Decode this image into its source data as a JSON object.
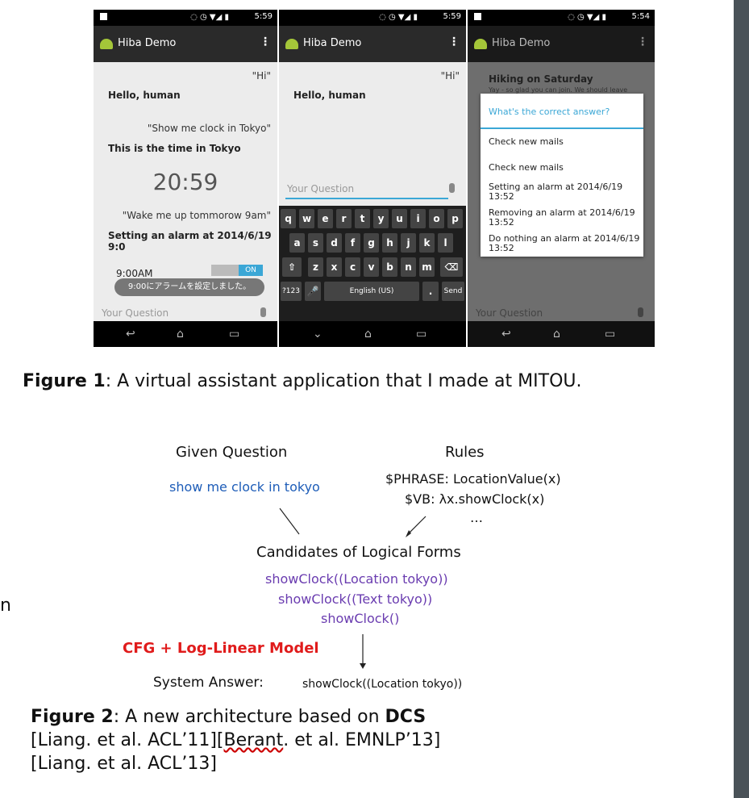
{
  "phones": {
    "p1": {
      "time": "5:59",
      "app_title": "Hiba Demo",
      "hi": "\"Hi\"",
      "hello": "Hello, human",
      "show": "\"Show me clock in Tokyo\"",
      "tokyo": "This is the time in Tokyo",
      "clock": "20:59",
      "wake": "\"Wake me up tommorow 9am\"",
      "alarm": "Setting an alarm at 2014/6/19\n9:0",
      "alarm_time": "9:00AM",
      "alarm_toggle": "ON",
      "toast": "9:00にアラームを設定しました。",
      "placeholder": "Your Question"
    },
    "p2": {
      "time": "5:59",
      "app_title": "Hiba Demo",
      "hi": "\"Hi\"",
      "hello": "Hello, human",
      "placeholder": "Your Question",
      "row1": [
        "q",
        "w",
        "e",
        "r",
        "t",
        "y",
        "u",
        "i",
        "o",
        "p"
      ],
      "row2": [
        "a",
        "s",
        "d",
        "f",
        "g",
        "h",
        "j",
        "k",
        "l"
      ],
      "row3": [
        "z",
        "x",
        "c",
        "v",
        "b",
        "n",
        "m"
      ],
      "key_123": "?123",
      "key_lang": "English (US)",
      "key_dot": ".",
      "key_send": "Send"
    },
    "p3": {
      "time": "5:54",
      "app_title": "Hiba Demo",
      "bg_title": "Hiking on Saturday",
      "bg_sub": "Yay - so glad you can join. We should leave",
      "dialog_title": "What's the correct answer?",
      "options": [
        "Check new mails",
        "Check new mails",
        "Setting an alarm at 2014/6/19\n13:52",
        "Removing an alarm at 2014/6/19\n13:52",
        "Do nothing an alarm at 2014/6/19\n13:52"
      ],
      "placeholder": "Your Question"
    }
  },
  "figure1": {
    "label": "Figure 1",
    "text": ": A virtual assistant application that I made at MITOU."
  },
  "diagram": {
    "given_title": "Given Question",
    "given_text": "show me clock in tokyo",
    "rules_title": "Rules",
    "rule1": "$PHRASE: LocationValue(x)",
    "rule2": "$VB: λx.showClock(x)",
    "rule_more": "…",
    "candidates_title": "Candidates of Logical Forms",
    "cand1": "showClock((Location tokyo))",
    "cand2": "showClock((Text tokyo))",
    "cand3": "showClock()",
    "model_label": "CFG + Log-Linear Model",
    "system_label": "System Answer:",
    "system_value": "showClock((Location tokyo))"
  },
  "figure2": {
    "label": "Figure 2",
    "text": ": A new architecture based on ",
    "dcs": "DCS",
    "line2a": "[Liang. et al. ACL’11][",
    "line2b": "Berant",
    "line2c": ". et al. EMNLP’13]",
    "line3": "[Liang. et al. ACL’13]"
  },
  "left_edge_char": "n"
}
